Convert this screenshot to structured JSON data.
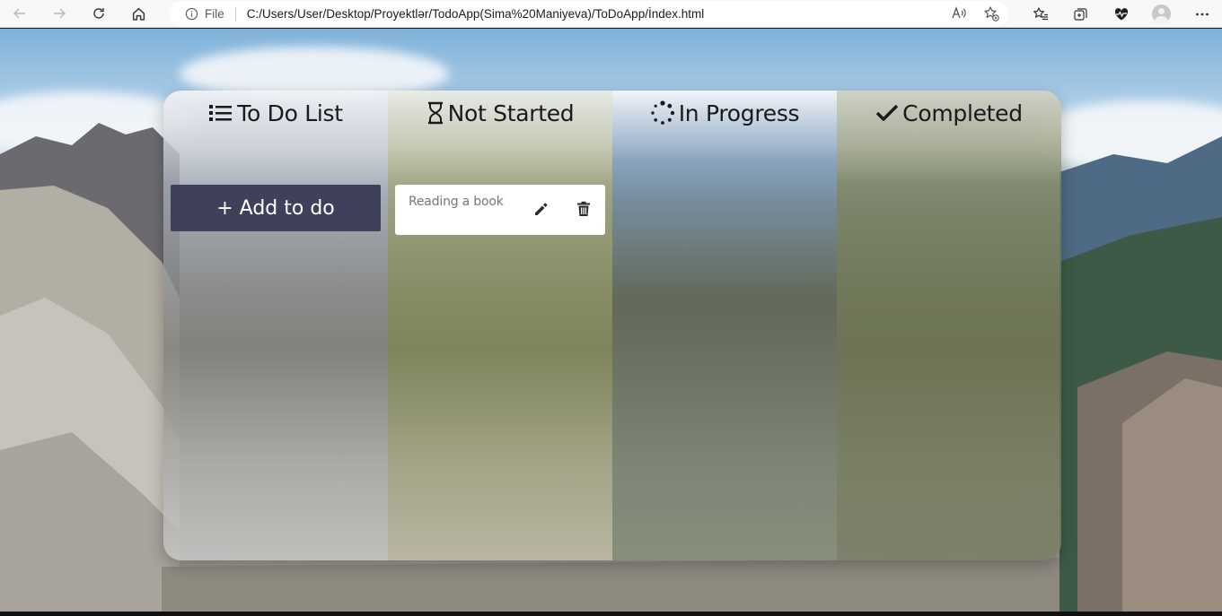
{
  "browser": {
    "address": {
      "scheme_label": "File",
      "url": "C:/Users/User/Desktop/Proyektlər/TodoApp(Sima%20Maniyeva)/ToDoApp/İndex.html"
    }
  },
  "board": {
    "columns": [
      {
        "title": "To Do List",
        "icon": "list-icon"
      },
      {
        "title": "Not Started",
        "icon": "hourglass-icon"
      },
      {
        "title": "In Progress",
        "icon": "spinner-icon"
      },
      {
        "title": "Completed",
        "icon": "check-icon"
      }
    ],
    "add_button_label": "+ Add to do",
    "not_started_tasks": [
      {
        "text": "Reading a book"
      }
    ]
  },
  "colors": {
    "add_button_bg": "#3f4059",
    "card_bg": "#ffffff",
    "task_text": "#777777"
  }
}
